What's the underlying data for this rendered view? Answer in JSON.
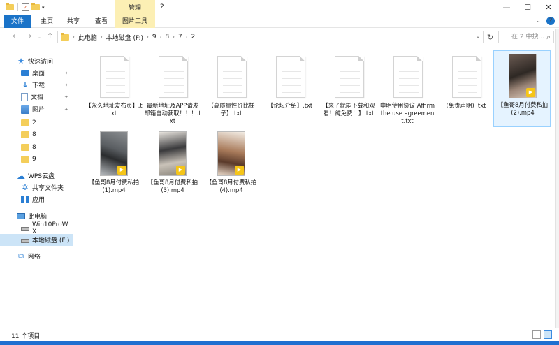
{
  "window": {
    "title": "2",
    "manage_tab": "管理",
    "controls": [
      "—",
      "☐",
      "✕"
    ]
  },
  "ribbon": {
    "tabs": [
      {
        "label": "文件",
        "active": true
      },
      {
        "label": "主页"
      },
      {
        "label": "共享"
      },
      {
        "label": "查看"
      },
      {
        "label": "图片工具"
      }
    ]
  },
  "address": {
    "crumbs": [
      "此电脑",
      "本地磁盘 (F:)",
      "9",
      "8",
      "7",
      "2"
    ],
    "search_placeholder": "在 2 中搜..."
  },
  "sidebar": {
    "items": [
      {
        "label": "快速访问",
        "icon": "star-icon"
      },
      {
        "label": "桌面",
        "icon": "desktop-icon",
        "pinned": true
      },
      {
        "label": "下载",
        "icon": "download-icon",
        "pinned": true
      },
      {
        "label": "文档",
        "icon": "document-icon",
        "pinned": true
      },
      {
        "label": "图片",
        "icon": "pictures-icon",
        "pinned": true
      },
      {
        "label": "2",
        "icon": "folder-icon"
      },
      {
        "label": "8",
        "icon": "folder-icon"
      },
      {
        "label": "8",
        "icon": "folder-icon"
      },
      {
        "label": "9",
        "icon": "folder-icon"
      },
      {
        "label": "WPS云盘",
        "icon": "cloud-icon"
      },
      {
        "label": "共享文件夹",
        "icon": "share-icon"
      },
      {
        "label": "应用",
        "icon": "apps-icon"
      },
      {
        "label": "此电脑",
        "icon": "computer-icon"
      },
      {
        "label": "Win10ProW X",
        "icon": "drive-icon"
      },
      {
        "label": "本地磁盘 (F:)",
        "icon": "drive-icon",
        "selected": true
      },
      {
        "label": "网络",
        "icon": "network-icon"
      }
    ]
  },
  "files": [
    {
      "name": "【永久地址发布页】.txt",
      "type": "txt"
    },
    {
      "name": "最新地址及APP请发邮箱自动获取！！！.txt",
      "type": "txt"
    },
    {
      "name": "【高质量性价比梯子】.txt",
      "type": "txt"
    },
    {
      "name": "【论坛介绍】.txt",
      "type": "txt"
    },
    {
      "name": "【来了就能下载和观看！纯免费！】.txt",
      "type": "txt"
    },
    {
      "name": "申明使用协议 Affirm the use agreement.txt",
      "type": "txt"
    },
    {
      "name": "(免责声明) .txt",
      "type": "txt"
    },
    {
      "name": "【鱼哥8月付费私拍 (2).mp4",
      "type": "mp4",
      "selected": true
    },
    {
      "name": "【鱼哥8月付费私拍 (1).mp4",
      "type": "mp4"
    },
    {
      "name": "【鱼哥8月付费私拍 (3).mp4",
      "type": "mp4"
    },
    {
      "name": "【鱼哥8月付费私拍 (4).mp4",
      "type": "mp4"
    }
  ],
  "status": {
    "count": "11 个项目"
  }
}
